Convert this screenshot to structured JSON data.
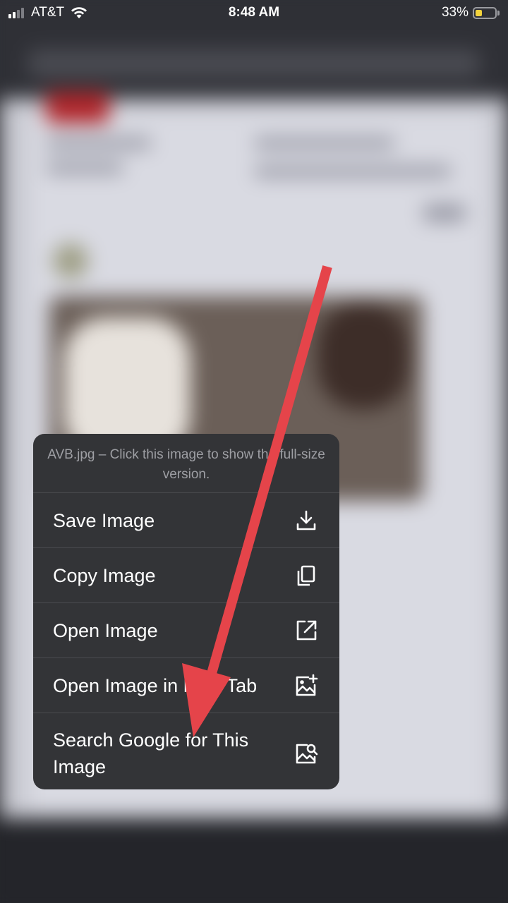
{
  "status_bar": {
    "carrier": "AT&T",
    "time": "8:48 AM",
    "battery_percent": "33%",
    "battery_level": 0.33,
    "battery_color": "#f3d33c",
    "signal_bars": 2
  },
  "context_menu": {
    "caption": "AVB.jpg – Click this image to show the full-size version.",
    "items": [
      {
        "label": "Save Image",
        "icon": "download-icon"
      },
      {
        "label": "Copy Image",
        "icon": "copy-icon"
      },
      {
        "label": "Open Image",
        "icon": "open-external-icon"
      },
      {
        "label": "Open Image in New Tab",
        "icon": "image-plus-icon"
      },
      {
        "label": "Search Google for This Image",
        "icon": "image-search-icon"
      }
    ]
  },
  "annotation": {
    "arrow_color": "#e5444a"
  }
}
